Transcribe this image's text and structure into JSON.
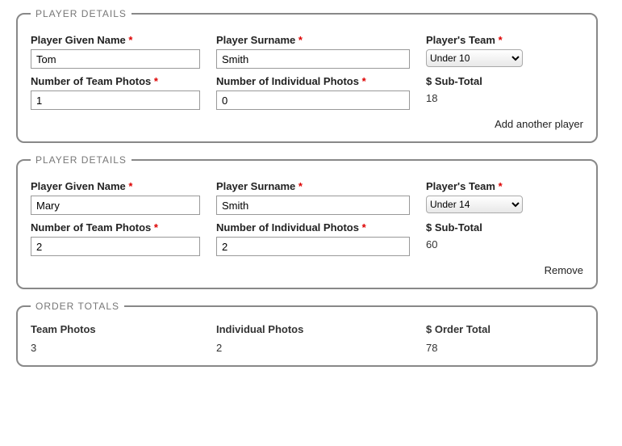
{
  "players": [
    {
      "legend": "PLAYER DETAILS",
      "labels": {
        "given_name": "Player Given Name",
        "surname": "Player Surname",
        "team": "Player's Team",
        "team_photos": "Number of Team Photos",
        "individual_photos": "Number of Individual Photos",
        "subtotal": "$ Sub-Total"
      },
      "values": {
        "given_name": "Tom",
        "surname": "Smith",
        "team": "Under 10",
        "team_photos": "1",
        "individual_photos": "0",
        "subtotal": "18"
      },
      "action": "Add another player"
    },
    {
      "legend": "PLAYER DETAILS",
      "labels": {
        "given_name": "Player Given Name",
        "surname": "Player Surname",
        "team": "Player's Team",
        "team_photos": "Number of Team Photos",
        "individual_photos": "Number of Individual Photos",
        "subtotal": "$ Sub-Total"
      },
      "values": {
        "given_name": "Mary",
        "surname": "Smith",
        "team": "Under 14",
        "team_photos": "2",
        "individual_photos": "2",
        "subtotal": "60"
      },
      "action": "Remove"
    }
  ],
  "totals": {
    "legend": "ORDER TOTALS",
    "labels": {
      "team_photos": "Team Photos",
      "individual_photos": "Individual Photos",
      "order_total": "$ Order Total"
    },
    "values": {
      "team_photos": "3",
      "individual_photos": "2",
      "order_total": "78"
    }
  },
  "required_mark": "*"
}
